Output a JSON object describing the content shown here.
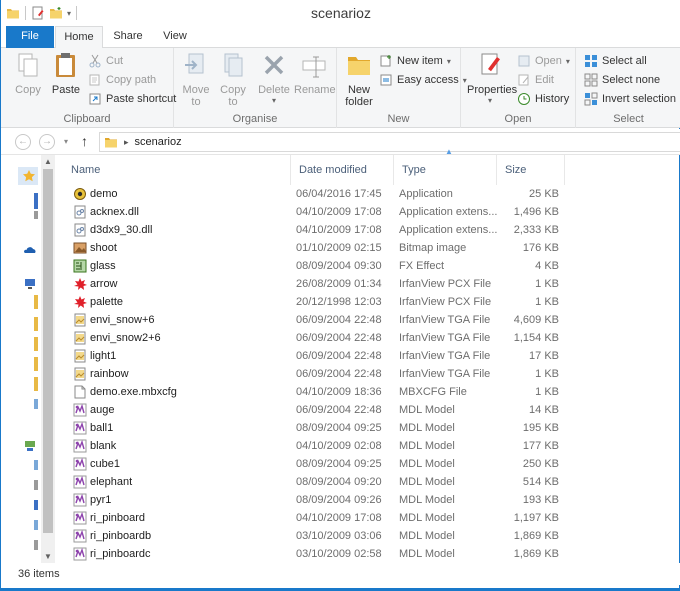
{
  "window": {
    "title": "scenarioz"
  },
  "tabs": {
    "file": "File",
    "home": "Home",
    "share": "Share",
    "view": "View"
  },
  "ribbon": {
    "clipboard": {
      "label": "Clipboard",
      "copy": "Copy",
      "paste": "Paste",
      "cut": "Cut",
      "copy_path": "Copy path",
      "paste_shortcut": "Paste shortcut"
    },
    "organise": {
      "label": "Organise",
      "move_to_1": "Move",
      "move_to_2": "to",
      "copy_to_1": "Copy",
      "copy_to_2": "to",
      "delete": "Delete",
      "rename": "Rename"
    },
    "new": {
      "label": "New",
      "new_folder_1": "New",
      "new_folder_2": "folder",
      "new_item": "New item",
      "easy_access": "Easy access"
    },
    "open": {
      "label": "Open",
      "properties": "Properties",
      "open": "Open",
      "edit": "Edit",
      "history": "History"
    },
    "select": {
      "label": "Select",
      "select_all": "Select all",
      "select_none": "Select none",
      "invert_selection": "Invert selection"
    }
  },
  "address": {
    "folder": "scenarioz"
  },
  "columns": {
    "name": "Name",
    "date": "Date modified",
    "type": "Type",
    "size": "Size"
  },
  "files": [
    {
      "name": "demo",
      "date": "06/04/2016 17:45",
      "type": "Application",
      "size": "25 KB",
      "icon": "application-icon"
    },
    {
      "name": "acknex.dll",
      "date": "04/10/2009 17:08",
      "type": "Application extens...",
      "size": "1,496 KB",
      "icon": "dll-icon"
    },
    {
      "name": "d3dx9_30.dll",
      "date": "04/10/2009 17:08",
      "type": "Application extens...",
      "size": "2,333 KB",
      "icon": "dll-icon"
    },
    {
      "name": "shoot",
      "date": "01/10/2009 02:15",
      "type": "Bitmap image",
      "size": "176 KB",
      "icon": "bitmap-icon"
    },
    {
      "name": "glass",
      "date": "08/09/2004 09:30",
      "type": "FX Effect",
      "size": "4 KB",
      "icon": "fx-icon"
    },
    {
      "name": "arrow",
      "date": "26/08/2009 01:34",
      "type": "IrfanView PCX File",
      "size": "1 KB",
      "icon": "irfanview-icon"
    },
    {
      "name": "palette",
      "date": "20/12/1998 12:03",
      "type": "IrfanView PCX File",
      "size": "1 KB",
      "icon": "irfanview-icon"
    },
    {
      "name": "envi_snow+6",
      "date": "06/09/2004 22:48",
      "type": "IrfanView TGA File",
      "size": "4,609 KB",
      "icon": "tga-icon"
    },
    {
      "name": "envi_snow2+6",
      "date": "06/09/2004 22:48",
      "type": "IrfanView TGA File",
      "size": "1,154 KB",
      "icon": "tga-icon"
    },
    {
      "name": "light1",
      "date": "06/09/2004 22:48",
      "type": "IrfanView TGA File",
      "size": "17 KB",
      "icon": "tga-icon"
    },
    {
      "name": "rainbow",
      "date": "06/09/2004 22:48",
      "type": "IrfanView TGA File",
      "size": "1 KB",
      "icon": "tga-icon"
    },
    {
      "name": "demo.exe.mbxcfg",
      "date": "04/10/2009 18:36",
      "type": "MBXCFG File",
      "size": "1 KB",
      "icon": "blank-file-icon"
    },
    {
      "name": "auge",
      "date": "06/09/2004 22:48",
      "type": "MDL Model",
      "size": "14 KB",
      "icon": "mdl-icon"
    },
    {
      "name": "ball1",
      "date": "08/09/2004 09:25",
      "type": "MDL Model",
      "size": "195 KB",
      "icon": "mdl-icon"
    },
    {
      "name": "blank",
      "date": "04/10/2009 02:08",
      "type": "MDL Model",
      "size": "177 KB",
      "icon": "mdl-icon"
    },
    {
      "name": "cube1",
      "date": "08/09/2004 09:25",
      "type": "MDL Model",
      "size": "250 KB",
      "icon": "mdl-icon"
    },
    {
      "name": "elephant",
      "date": "08/09/2004 09:20",
      "type": "MDL Model",
      "size": "514 KB",
      "icon": "mdl-icon"
    },
    {
      "name": "pyr1",
      "date": "08/09/2004 09:26",
      "type": "MDL Model",
      "size": "193 KB",
      "icon": "mdl-icon"
    },
    {
      "name": "ri_pinboard",
      "date": "04/10/2009 17:08",
      "type": "MDL Model",
      "size": "1,197 KB",
      "icon": "mdl-icon"
    },
    {
      "name": "ri_pinboardb",
      "date": "03/10/2009 03:06",
      "type": "MDL Model",
      "size": "1,869 KB",
      "icon": "mdl-icon"
    },
    {
      "name": "ri_pinboardc",
      "date": "03/10/2009 02:58",
      "type": "MDL Model",
      "size": "1,869 KB",
      "icon": "mdl-icon"
    }
  ],
  "status": {
    "item_count": "36 items"
  },
  "colors": {
    "accent": "#1979ca",
    "ribbon_bg": "#f5f6f7",
    "header_text": "#4c607a"
  }
}
